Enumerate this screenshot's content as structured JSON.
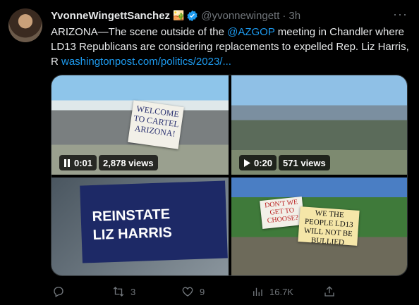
{
  "tweet": {
    "display_name": "YvonneWingettSanchez",
    "name_emoji": "🏜️",
    "handle": "@yvonnewingett",
    "separator": "·",
    "time": "3h",
    "more_glyph": "···",
    "text_part1": "ARIZONA—The scene outside of the ",
    "mention": "@AZGOP",
    "text_part2": " meeting in Chandler where LD13 Republicans are considering replacements to expelled Rep. Liz Harris, R ",
    "link": "washingtonpost.com/politics/2023/..."
  },
  "media": {
    "video1": {
      "time": "0:01",
      "views": "2,878 views",
      "sign_text": "WELCOME TO CARTEL ARIZONA!"
    },
    "video2": {
      "time": "0:20",
      "views": "571 views"
    },
    "photo3": {
      "banner_text_line1": "REINSTATE",
      "banner_text_line2": "LIZ HARRIS"
    },
    "photo4": {
      "sign_a": "DON'T WE GET TO CHOOSE?",
      "sign_b": "WE THE PEOPLE LD13 WILL NOT BE BULLIED"
    }
  },
  "actions": {
    "reply": {
      "icon": "reply-icon",
      "count": ""
    },
    "retweet": {
      "icon": "retweet-icon",
      "count": "3"
    },
    "like": {
      "icon": "heart-icon",
      "count": "9"
    },
    "views": {
      "icon": "views-icon",
      "count": "16.7K"
    },
    "share": {
      "icon": "share-icon",
      "count": ""
    }
  },
  "colors": {
    "link": "#1d9bf0",
    "muted": "#71767b",
    "verified": "#1d9bf0"
  }
}
